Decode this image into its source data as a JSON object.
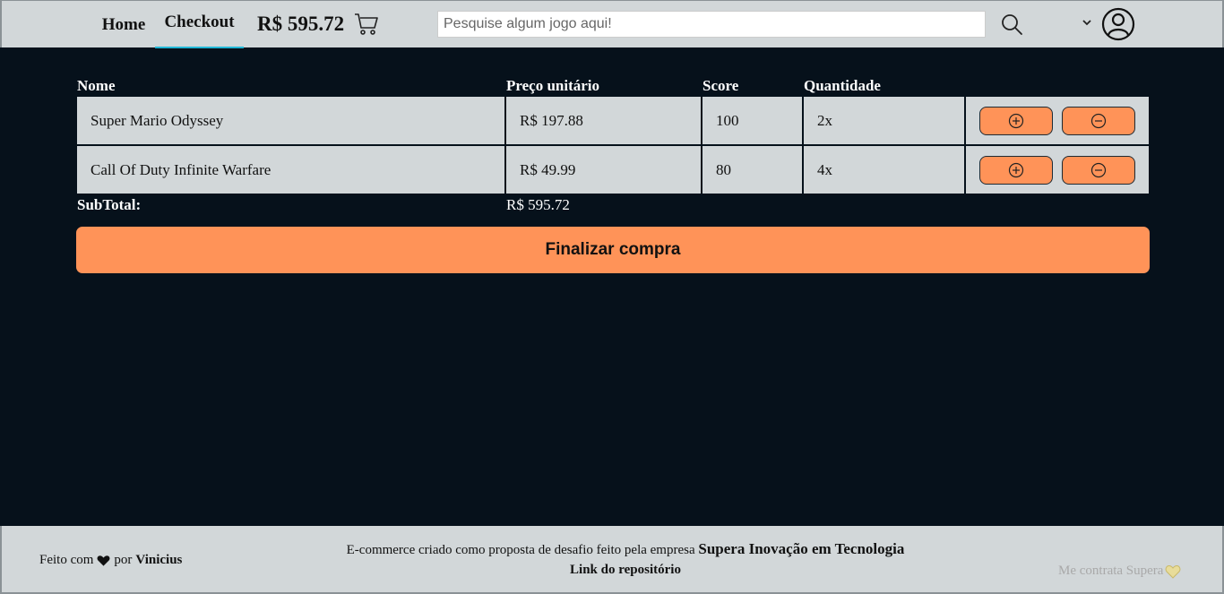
{
  "header": {
    "nav": {
      "home_label": "Home",
      "checkout_label": "Checkout"
    },
    "cart_total": "R$ 595.72",
    "search": {
      "placeholder": "Pesquise algum jogo aqui!",
      "value": ""
    },
    "icons": {
      "cart": "cart-icon",
      "search": "search-icon",
      "dropdown": "chevron-down-icon",
      "user": "user-icon"
    }
  },
  "cart_table": {
    "columns": {
      "name": "Nome",
      "unit_price": "Preço unitário",
      "score": "Score",
      "quantity": "Quantidade"
    },
    "rows": [
      {
        "name": "Super Mario Odyssey",
        "unit_price": "R$ 197.88",
        "score": "100",
        "quantity": "2x"
      },
      {
        "name": "Call Of Duty Infinite Warfare",
        "unit_price": "R$ 49.99",
        "score": "80",
        "quantity": "4x"
      }
    ],
    "subtotal_label": "SubTotal:",
    "subtotal_value": "R$ 595.72"
  },
  "checkout_button_label": "Finalizar compra",
  "footer": {
    "made_with_prefix": "Feito com",
    "made_with_by": "por",
    "author": "Vinicius",
    "description": "E-commerce criado como proposta de desafio feito pela empresa",
    "company": "Supera Inovação em Tecnologia",
    "repo_link": "Link do repositório",
    "hire_me": "Me contrata Supera"
  },
  "colors": {
    "background": "#06111b",
    "panel": "#d2d7d9",
    "accent": "#ff9358",
    "tab_underline": "#1fb6d6"
  }
}
